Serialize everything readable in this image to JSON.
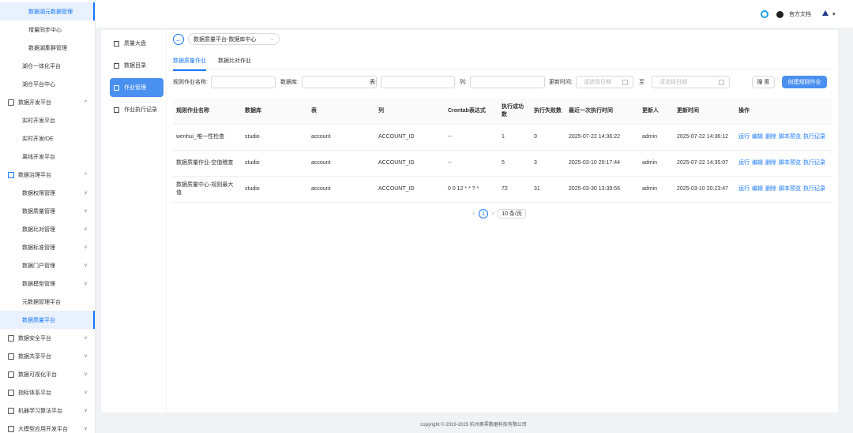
{
  "sidebar": {
    "items": [
      {
        "label": "数据湖元数据管理",
        "level": 3,
        "selected": true
      },
      {
        "label": "增量同步中心",
        "level": 3
      },
      {
        "label": "数据湖集群管理",
        "level": 3
      },
      {
        "label": "湖仓一体化平台",
        "level": 2
      },
      {
        "label": "湖仓平台中心",
        "level": 2
      },
      {
        "label": "数据开发平台",
        "level": 1,
        "chevron": "^",
        "icon": "code-icon"
      },
      {
        "label": "实时开发平台",
        "level": 2
      },
      {
        "label": "实时开发IDE",
        "level": 2
      },
      {
        "label": "离线开发平台",
        "level": 2
      },
      {
        "label": "数据治理平台",
        "level": 1,
        "chevron": "^",
        "icon": "governance-icon",
        "open": true
      },
      {
        "label": "数据权限管理",
        "level": 2,
        "chevron": "v"
      },
      {
        "label": "数据质量管理",
        "level": 2,
        "chevron": "v"
      },
      {
        "label": "数据比对管理",
        "level": 2,
        "chevron": "v"
      },
      {
        "label": "数据标准管理",
        "level": 2,
        "chevron": "v"
      },
      {
        "label": "数据门户管理",
        "level": 2,
        "chevron": "v"
      },
      {
        "label": "数据模型管理",
        "level": 2,
        "chevron": "v"
      },
      {
        "label": "元数据管理平台",
        "level": 2
      },
      {
        "label": "数据质量平台",
        "level": 2,
        "selected": true
      },
      {
        "label": "数据安全平台",
        "level": 1,
        "chevron": "v",
        "icon": "security-icon"
      },
      {
        "label": "数据共享平台",
        "level": 1,
        "chevron": "v",
        "icon": "share-icon"
      },
      {
        "label": "数据可视化平台",
        "level": 1,
        "chevron": "v",
        "icon": "visualization-icon"
      },
      {
        "label": "指标体系平台",
        "level": 1,
        "chevron": "v",
        "icon": "metrics-icon"
      },
      {
        "label": "机器学习算法平台",
        "level": 1,
        "chevron": "v",
        "icon": "ml-icon"
      },
      {
        "label": "大模型应用开发平台",
        "level": 1,
        "chevron": "v",
        "icon": "llm-icon"
      }
    ]
  },
  "topbar": {
    "docs": "官方文档",
    "user_chevron": "▾"
  },
  "subnav": {
    "items": [
      {
        "label": "质量大盘",
        "icon": "chart-icon"
      },
      {
        "label": "数据目录",
        "icon": "catalog-icon"
      },
      {
        "label": "作业管理",
        "icon": "list-icon",
        "active": true
      },
      {
        "label": "作业执行记录",
        "icon": "record-icon"
      }
    ]
  },
  "main": {
    "back": "←",
    "datasource": "数据质量平台-数据库中心",
    "tabs": [
      "数据质量作业",
      "数据比对作业"
    ],
    "filters": {
      "job_name": "规则作业名称:",
      "database": "数据库:",
      "table": "表:",
      "column": "列:",
      "update_time": "更新时间:",
      "date_placeholder": "请选择日期",
      "to": "至",
      "search": "搜 索",
      "create": "创建规则作业"
    },
    "table": {
      "headers": [
        "规则作业名称",
        "数据库",
        "表",
        "列",
        "Crontab表达式",
        "执行成功数",
        "执行失败数",
        "最近一次执行时间",
        "更新人",
        "更新时间",
        "操作"
      ],
      "rows": [
        [
          "wenhui_唯一性检查",
          "studio",
          "account",
          "ACCOUNT_ID",
          "--",
          "1",
          "0",
          "2025-07-22 14:36:22",
          "admin",
          "2025-07-22 14:36:12"
        ],
        [
          "数据质量作业-空值稽查",
          "studio",
          "account",
          "ACCOUNT_ID",
          "--",
          "5",
          "3",
          "2025-03-10 20:17:44",
          "admin",
          "2025-07-22 14:35:07"
        ],
        [
          "数据质量中心-规则最大值",
          "studio",
          "account",
          "ACCOUNT_ID",
          "0 0 12 * * ? *",
          "72",
          "31",
          "2025-03-30 13:39:56",
          "admin",
          "2025-03-10 20:23:47"
        ]
      ],
      "actions": [
        "运行",
        "编辑",
        "删除",
        "脚本预览",
        "执行记录"
      ]
    },
    "pager": {
      "prev": "<",
      "page": "1",
      "next": ">",
      "size": "10 条/页"
    }
  },
  "footer": "copyright © 2019-2025 杭州奥零数据科技有限公司"
}
